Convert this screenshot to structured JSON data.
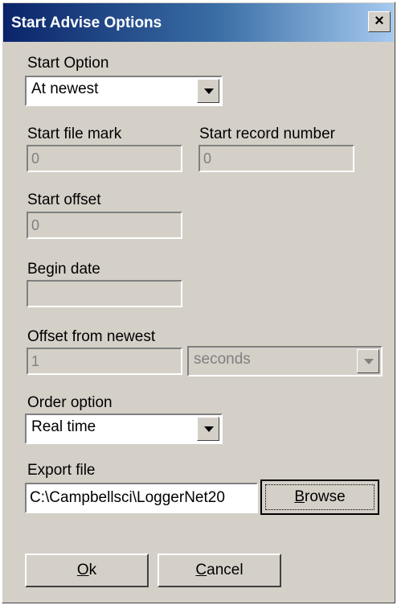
{
  "window": {
    "title": "Start Advise Options",
    "close_label": "×"
  },
  "start_option": {
    "label": "Start Option",
    "value": "At newest"
  },
  "start_file_mark": {
    "label": "Start file mark",
    "value": "0"
  },
  "start_record_number": {
    "label": "Start record number",
    "value": "0"
  },
  "start_offset": {
    "label": "Start offset",
    "value": "0"
  },
  "begin_date": {
    "label": "Begin date",
    "value": ""
  },
  "offset_from_newest": {
    "label": "Offset from newest",
    "value": "1",
    "unit": "seconds"
  },
  "order_option": {
    "label": "Order option",
    "value": "Real time"
  },
  "export_file": {
    "label": "Export file",
    "value": "C:\\Campbellsci\\LoggerNet20",
    "browse_first": "B",
    "browse_rest": "rowse"
  },
  "buttons": {
    "ok_first": "O",
    "ok_rest": "k",
    "cancel_first": "C",
    "cancel_rest": "ancel"
  }
}
